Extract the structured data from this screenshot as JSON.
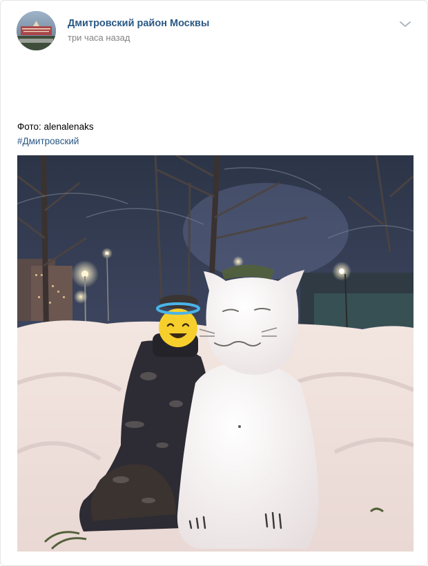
{
  "post": {
    "author": "Дмитровский район Москвы",
    "time": "три часа назад",
    "caption": "Фото: alenalenaks",
    "hashtag": "#Дмитровский"
  },
  "icons": {
    "avatar": "community-avatar",
    "more": "chevron-down-icon"
  },
  "colors": {
    "link": "#2a5885",
    "meta": "#828282",
    "border": "#e3e4e8"
  }
}
